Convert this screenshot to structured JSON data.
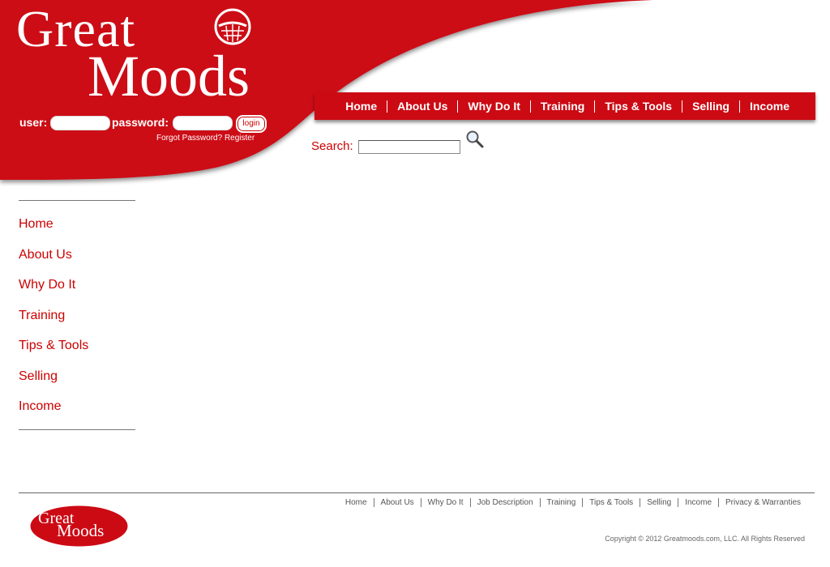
{
  "logo": {
    "line1": "Great",
    "line2": "Moods"
  },
  "login": {
    "user_label": "user:",
    "password_label": "password:",
    "button": "login",
    "forgot": "Forgot Password?",
    "register": "Register"
  },
  "topnav": {
    "items": [
      "Home",
      "About Us",
      "Why Do It",
      "Training",
      "Tips & Tools",
      "Selling",
      "Income"
    ]
  },
  "search": {
    "label": "Search:",
    "value": ""
  },
  "sidenav": {
    "items": [
      "Home",
      "About Us",
      "Why Do It",
      "Training",
      "Tips & Tools",
      "Selling",
      "Income"
    ]
  },
  "footer": {
    "links": [
      "Home",
      "About Us",
      "Why Do It",
      "Job Description",
      "Training",
      "Tips & Tools",
      "Selling",
      "Income",
      "Privacy & Warranties"
    ],
    "copyright": "Copyright © 2012 Greatmoods.com, LLC. All Rights Reserved",
    "logo_line1": "Great",
    "logo_line2": "Moods"
  },
  "colors": {
    "brand_red": "#cc0a14",
    "link_red": "#cc0000"
  }
}
